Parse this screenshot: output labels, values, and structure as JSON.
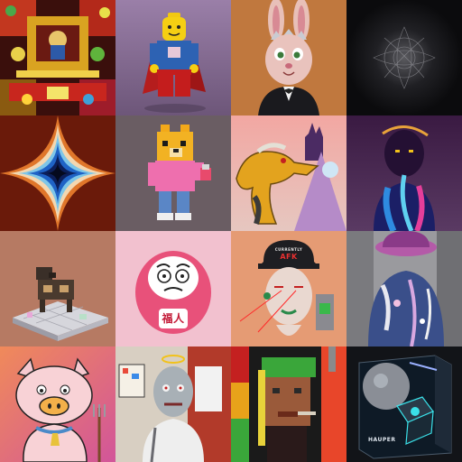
{
  "gallery": {
    "tiles": [
      {
        "id": "temple-collage",
        "caption": ""
      },
      {
        "id": "lego-superhero",
        "caption": ""
      },
      {
        "id": "bunny-king",
        "caption": ""
      },
      {
        "id": "dark-fractal",
        "caption": ""
      },
      {
        "id": "rainbow-star",
        "caption": ""
      },
      {
        "id": "voxel-dog",
        "caption": ""
      },
      {
        "id": "pixel-dragon",
        "caption": ""
      },
      {
        "id": "galaxy-figure",
        "caption": ""
      },
      {
        "id": "voxel-dog-diorama",
        "caption": ""
      },
      {
        "id": "daruma-doll",
        "caption": "福人"
      },
      {
        "id": "afk-cyborg",
        "caption": "AFK",
        "cap_small": "CURRENTLY"
      },
      {
        "id": "paint-splatter-person",
        "caption": ""
      },
      {
        "id": "cartoon-pig",
        "caption": ""
      },
      {
        "id": "zombie-artist",
        "caption": ""
      },
      {
        "id": "pixel-punk",
        "caption": ""
      },
      {
        "id": "game-box",
        "caption": "HAUPER"
      }
    ]
  },
  "colors": {
    "daruma_pink": "#e8517a",
    "cyborg_bg": "#e59b74",
    "pig_bg": "#e7706b",
    "punk_green": "#3aa63a"
  }
}
